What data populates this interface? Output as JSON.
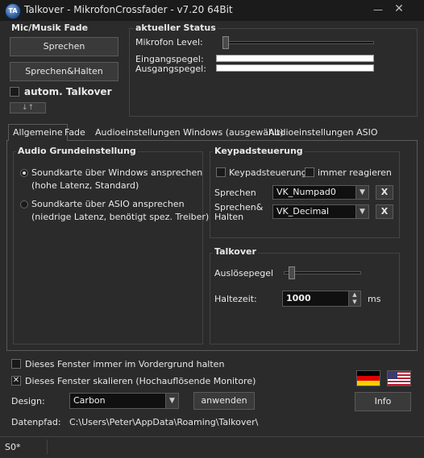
{
  "window": {
    "title": "Talkover - MikrofonCrossfader  -  v7.20 64Bit",
    "icon_text": "TA"
  },
  "mic_fade": {
    "title": "Mic/Musik Fade",
    "sprechen_label": "Sprechen",
    "sprechen_halten_label": "Sprechen&Halten",
    "auto_talkover_label": "autom. Talkover",
    "arrows_label": "↓↑"
  },
  "status": {
    "title": "aktueller Status",
    "mic_level_label": "Mikrofon Level:",
    "eingang_label": "Eingangspegel:",
    "ausgang_label": "Ausgangspegel:"
  },
  "tabs": [
    {
      "label": "Allgemeine"
    },
    {
      "label": "Fade"
    },
    {
      "label": "Audioeinstellungen Windows (ausgewählt)"
    },
    {
      "label": "Audioeinstellungen ASIO"
    }
  ],
  "audio": {
    "title": "Audio Grundeinstellung",
    "opt1_line1": "Soundkarte über Windows ansprechen",
    "opt1_line2": "(hohe Latenz, Standard)",
    "opt2_line1": "Soundkarte über ASIO ansprechen",
    "opt2_line2": "(niedrige Latenz, benötigt spez. Treiber)"
  },
  "keypad": {
    "title": "Keypadsteuerung",
    "enable_label": "Keypadsteuerung",
    "always_label": "immer reagieren",
    "sprechen_label": "Sprechen",
    "sprechen_value": "VK_Numpad0",
    "halten_label_1": "Sprechen&",
    "halten_label_2": "Halten",
    "halten_value": "VK_Decimal",
    "x_label": "X"
  },
  "talkover": {
    "title": "Talkover",
    "trigger_label": "Auslösepegel",
    "hold_label": "Haltezeit:",
    "hold_value": "1000",
    "hold_unit": "ms"
  },
  "bottom": {
    "foreground_label": "Dieses Fenster immer im Vordergrund halten",
    "scale_label": "Dieses Fenster skalieren (Hochauflösende Monitore)",
    "design_label": "Design:",
    "design_value": "Carbon",
    "apply_label": "anwenden",
    "info_label": "Info",
    "path_label": "Datenpfad:",
    "path_value": "C:\\Users\\Peter\\AppData\\Roaming\\Talkover\\"
  },
  "statusbar": {
    "text": "S0*"
  },
  "colors": {
    "background": "#2b2b2b",
    "titlebar": "#1b1b1b",
    "accent": "#ffffff"
  }
}
